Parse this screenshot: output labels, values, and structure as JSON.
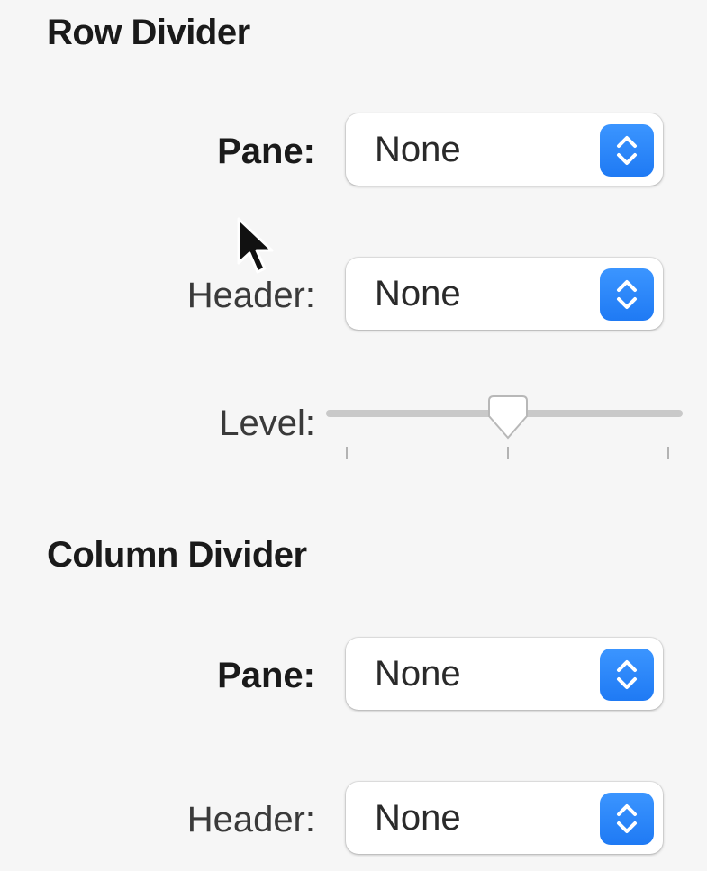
{
  "row_divider": {
    "title": "Row Divider",
    "pane": {
      "label": "Pane:",
      "value": "None"
    },
    "header": {
      "label": "Header:",
      "value": "None"
    },
    "level": {
      "label": "Level:",
      "value_fraction": 0.5,
      "tick_count": 3
    }
  },
  "column_divider": {
    "title": "Column Divider",
    "pane": {
      "label": "Pane:",
      "value": "None"
    },
    "header": {
      "label": "Header:",
      "value": "None"
    }
  },
  "colors": {
    "background": "#f6f6f6",
    "accent": "#1f7af4",
    "track": "#c9c9c9"
  },
  "icons": {
    "stepper": "chevron-up-down-icon",
    "cursor": "mouse-pointer-icon"
  }
}
